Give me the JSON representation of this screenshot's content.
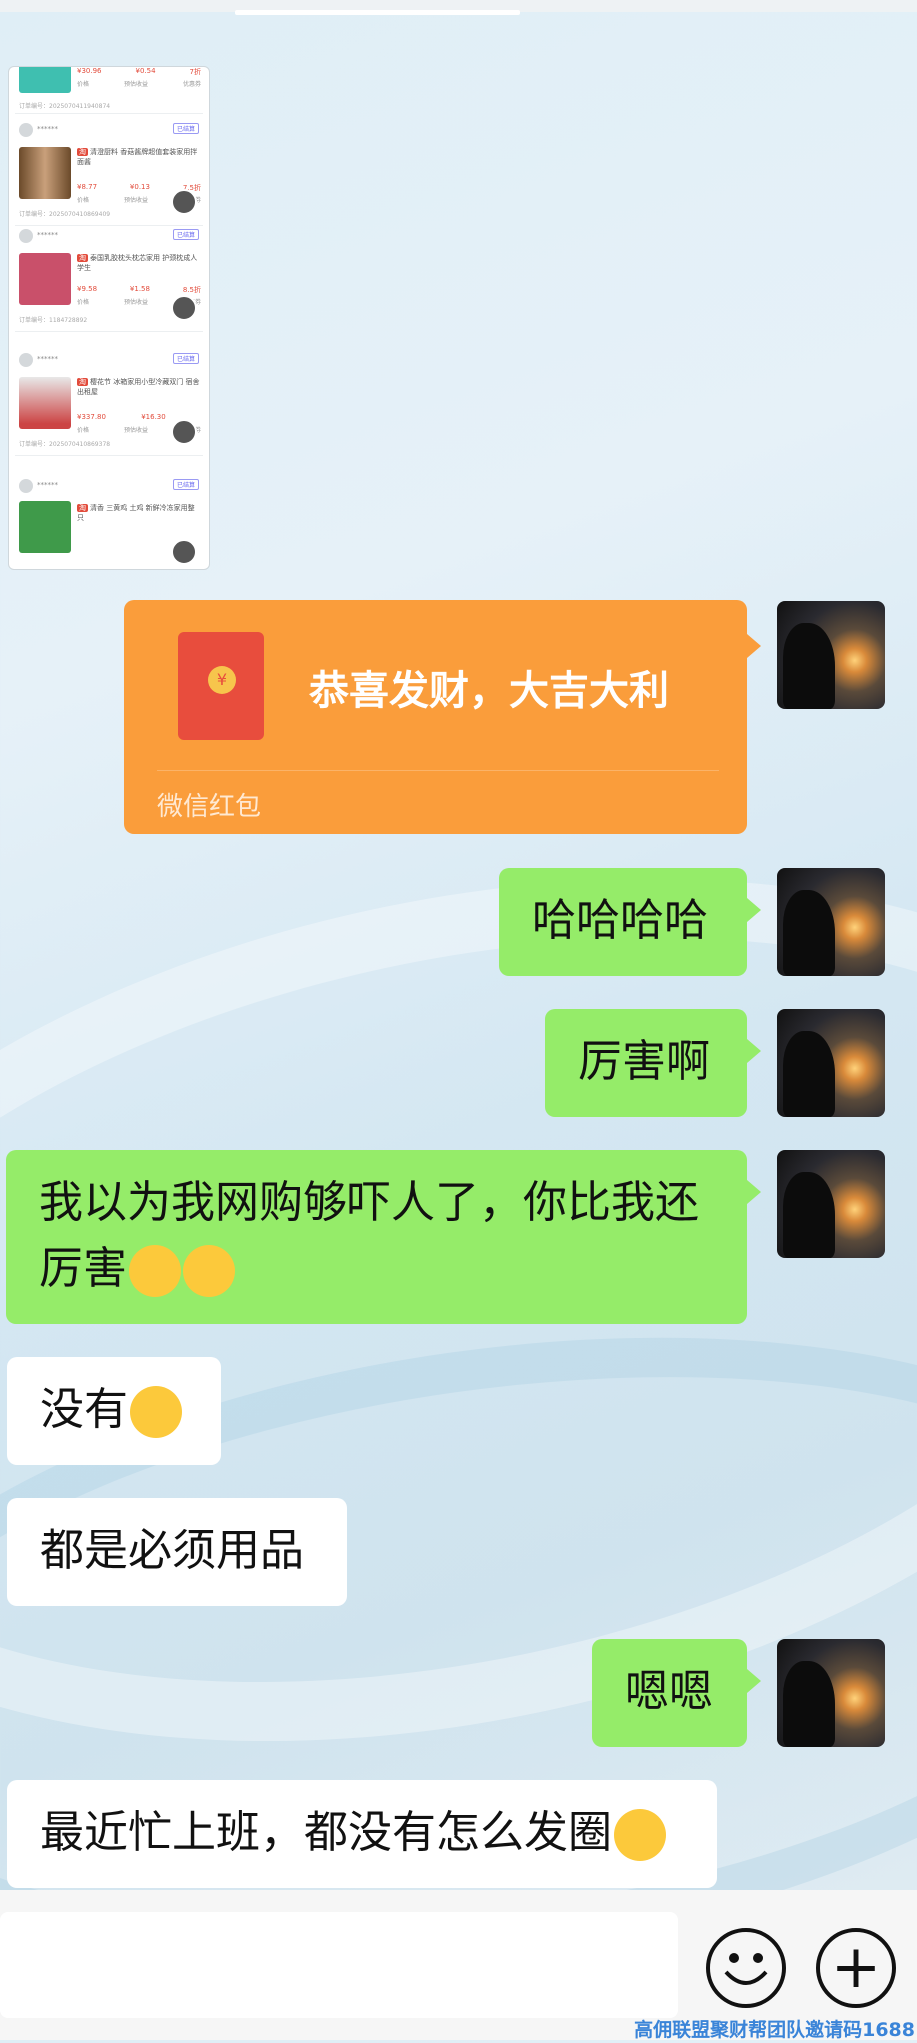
{
  "shared_screenshot": {
    "orders": [
      {
        "user": "******",
        "status": "",
        "title": "",
        "prices": [
          "¥30.96",
          "¥0.54",
          "7折"
        ],
        "labels": [
          "价格",
          "预估收益",
          "优惠券"
        ],
        "footer": "订单编号：2025070411940874"
      },
      {
        "user": "******",
        "status": "已结算",
        "title": "清澄厨料 香菇酱牌超值套装家用拌面酱",
        "prices": [
          "¥8.77",
          "¥0.13",
          "7.5折"
        ],
        "labels": [
          "价格",
          "预估收益",
          "优惠券"
        ],
        "footer": "订单编号：2025070410869409"
      },
      {
        "user": "******",
        "status": "已结算",
        "title": "泰国乳胶枕头枕芯家用 护颈枕成人学生",
        "prices": [
          "¥9.58",
          "¥1.58",
          "8.5折"
        ],
        "labels": [
          "价格",
          "预估收益",
          "优惠券"
        ],
        "footer": "订单编号：1184728892"
      },
      {
        "user": "******",
        "status": "已结算",
        "title": "樱花节 冰箱家用小型冷藏双门 宿舍出租屋",
        "prices": [
          "¥337.80",
          "¥16.30",
          ""
        ],
        "labels": [
          "价格",
          "预估收益",
          "优惠券"
        ],
        "footer": "订单编号：2025070410869378"
      },
      {
        "user": "******",
        "status": "已结算",
        "title": "清香 三黄鸡 土鸡 新鲜冷冻家用整只",
        "prices": [
          "",
          "",
          ""
        ],
        "labels": [
          "",
          "",
          ""
        ],
        "footer": ""
      }
    ]
  },
  "red_packet": {
    "title": "恭喜发财，大吉大利",
    "label": "微信红包",
    "coin": "¥"
  },
  "messages": [
    {
      "side": "right",
      "text": "哈哈哈哈"
    },
    {
      "side": "right",
      "text": "厉害啊"
    },
    {
      "side": "right",
      "text": "我以为我网购够吓人了，你比我还厉害"
    },
    {
      "side": "left",
      "text": "没有"
    },
    {
      "side": "left",
      "text": "都是必须用品"
    },
    {
      "side": "right",
      "text": "嗯嗯"
    },
    {
      "side": "left",
      "text": "最近忙上班，都没有怎么发圈"
    }
  ],
  "input_bar": {
    "emoji_button": "emoji-icon",
    "plus_button": "+"
  },
  "watermark": "高佣联盟聚财帮团队邀请码1688",
  "colors": {
    "green_bubble": "#95ec69",
    "red_packet": "#fa9d3b",
    "white_bubble": "#ffffff"
  }
}
